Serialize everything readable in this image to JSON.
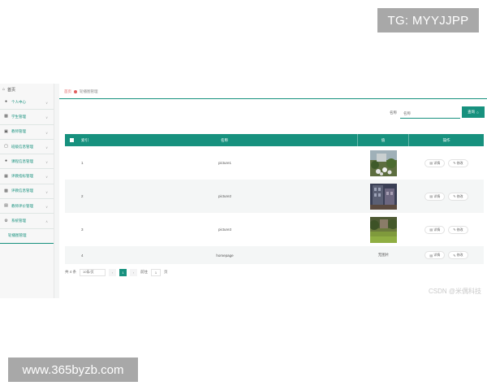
{
  "watermarks": {
    "top": "TG: MYYJJPP",
    "bottom": "www.365byzb.com",
    "csdn": "CSDN @米偶科技"
  },
  "sidebar": {
    "top_label": "首页",
    "items": [
      {
        "label": "个人中心",
        "icon": "user-icon"
      },
      {
        "label": "学生管理",
        "icon": "users-icon"
      },
      {
        "label": "教师管理",
        "icon": "teacher-icon"
      },
      {
        "label": "班级信息管理",
        "icon": "class-icon"
      },
      {
        "label": "课程信息管理",
        "icon": "course-icon"
      },
      {
        "label": "评教指标管理",
        "icon": "index-icon"
      },
      {
        "label": "评教信息管理",
        "icon": "evaluation-icon"
      },
      {
        "label": "教师评价管理",
        "icon": "review-icon"
      },
      {
        "label": "系统管理",
        "icon": "settings-icon"
      }
    ],
    "sub_item": "轮播图管理"
  },
  "breadcrumb": {
    "home": "首页",
    "current": "轮播图管理"
  },
  "search": {
    "label": "名称",
    "placeholder": "名称",
    "button": "查询"
  },
  "table": {
    "headers": {
      "index": "索引",
      "name": "名称",
      "image": "值",
      "operation": "操作"
    },
    "rows": [
      {
        "index": "1",
        "name": "picture1",
        "image": "thumb-1"
      },
      {
        "index": "2",
        "name": "picture2",
        "image": "thumb-2"
      },
      {
        "index": "3",
        "name": "picture3",
        "image": "thumb-3"
      },
      {
        "index": "4",
        "name": "homepage",
        "image_text": "无图片"
      }
    ],
    "op_view": "详情",
    "op_edit": "修改"
  },
  "pager": {
    "total": "共 4 条",
    "page_size": "10条/页",
    "current_page": "1",
    "goto_label": "前往",
    "goto_value": "1",
    "page_unit": "页"
  },
  "colors": {
    "accent": "#17917e",
    "breadcrumb_home": "#e05c5c"
  }
}
